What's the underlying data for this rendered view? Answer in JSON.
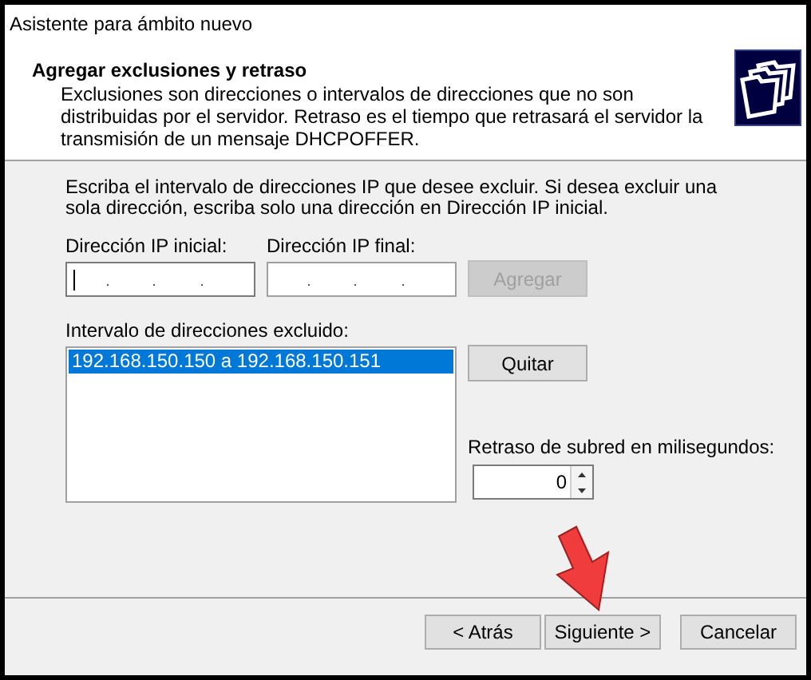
{
  "window": {
    "title": "Asistente para ámbito nuevo"
  },
  "header": {
    "title": "Agregar exclusiones y retraso",
    "description": "Exclusiones son direcciones o intervalos de direcciones que no son distribuidas por el servidor. Retraso es el tiempo que retrasará el servidor la transmisión de un mensaje DHCPOFFER."
  },
  "instructions": "Escriba el intervalo de direcciones IP que desee excluir. Si desea excluir una sola dirección, escriba solo una dirección en Dirección IP inicial.",
  "ip_fields": [
    {
      "label": "Dirección IP inicial:",
      "focused": true
    },
    {
      "label": "Dirección IP final:",
      "focused": false
    }
  ],
  "add_button": {
    "label": "Agregar",
    "disabled": true
  },
  "excluded": {
    "label": "Intervalo de direcciones excluido:",
    "items": [
      {
        "text": "192.168.150.150 a 192.168.150.151",
        "selected": true
      }
    ]
  },
  "remove_button": {
    "label": "Quitar",
    "disabled": false
  },
  "delay": {
    "label": "Retraso de subred en milisegundos:",
    "value": "0"
  },
  "buttons": [
    {
      "label": "< Atrás"
    },
    {
      "label": "Siguiente >"
    },
    {
      "label": "Cancelar"
    }
  ]
}
